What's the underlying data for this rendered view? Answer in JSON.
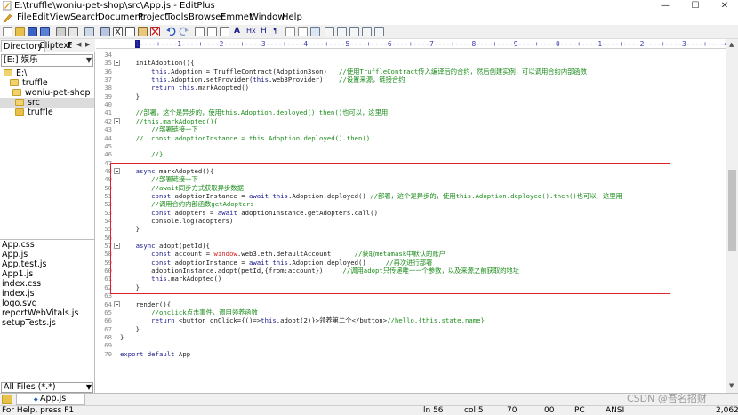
{
  "window": {
    "title": "E:\\truffle\\woniu-pet-shop\\src\\App.js - EditPlus",
    "minimize": "—",
    "maximize": "☐",
    "close": "✕"
  },
  "menu": [
    "File",
    "Edit",
    "View",
    "Search",
    "Document",
    "Project",
    "Tools",
    "Browser",
    "Emmet",
    "Window",
    "Help"
  ],
  "toolbar": {
    "buttons": [
      "new",
      "open",
      "save",
      "save-all",
      "print",
      "print-preview",
      "cut",
      "copy",
      "paste",
      "delete",
      "undo",
      "redo",
      "find",
      "replace",
      "go-to",
      "word-wrap",
      "hex",
      "html-preview",
      "bold",
      "italic",
      "browser",
      "ruler",
      "line-number",
      "settings",
      "cliptext",
      "directory",
      "output",
      "fullscreen",
      "window"
    ]
  },
  "sidebar": {
    "tabs": [
      "Directory",
      "Cliptext",
      "F"
    ],
    "drive": "[E:] 娱乐",
    "folders": [
      {
        "label": "E:\\",
        "level": 0,
        "open": true,
        "selected": false
      },
      {
        "label": "truffle",
        "level": 1,
        "open": true,
        "selected": false
      },
      {
        "label": "woniu-pet-shop",
        "level": 2,
        "open": true,
        "selected": false
      },
      {
        "label": "src",
        "level": 3,
        "open": true,
        "selected": true
      },
      {
        "label": "truffle",
        "level": 3,
        "open": false,
        "selected": false
      }
    ],
    "files": [
      "App.css",
      "App.js",
      "App.test.js",
      "App1.js",
      "index.css",
      "index.js",
      "logo.svg",
      "reportWebVitals.js",
      "setupTests.js"
    ],
    "filter": "All Files (*.*)"
  },
  "ruler": {
    "text": "1----+----1----+----2----+----3----+----4----+----5----+----6----+----7----+----8----+----9----+----0----+----1----+----2----+----3----+----4----+"
  },
  "editor": {
    "lines": [
      {
        "num": "34",
        "fold": false,
        "text": ""
      },
      {
        "num": "35",
        "fold": true,
        "text": "    initAdoption(){"
      },
      {
        "num": "36",
        "fold": false,
        "text": "        this.Adoption = TruffleContract(Adoption3son)   //使用TruffleContract传入编译后的合约，然后创建实例，可以调用合约内部函数"
      },
      {
        "num": "37",
        "fold": false,
        "text": "        this.Adoption.setProvider(this.web3Provider)    //设置来源，链接合约"
      },
      {
        "num": "38",
        "fold": false,
        "text": "        return this.markAdopted()"
      },
      {
        "num": "39",
        "fold": false,
        "text": "    }"
      },
      {
        "num": "40",
        "fold": false,
        "text": ""
      },
      {
        "num": "41",
        "fold": false,
        "text": "    //部署，这个是异步的，使用this.Adoption.deployed().then()也可以，这里用"
      },
      {
        "num": "42",
        "fold": true,
        "text": "    //this.markAdopted(){"
      },
      {
        "num": "43",
        "fold": false,
        "text": "        //部署链接一下"
      },
      {
        "num": "44",
        "fold": false,
        "text": "    //  const adoptionInstance = this.Adoption.deployed().then()"
      },
      {
        "num": "45",
        "fold": false,
        "text": ""
      },
      {
        "num": "46",
        "fold": false,
        "text": "        //}"
      },
      {
        "num": "47",
        "fold": false,
        "text": ""
      },
      {
        "num": "48",
        "fold": true,
        "text": "    async markAdopted(){"
      },
      {
        "num": "49",
        "fold": false,
        "text": "        //部署链接一下"
      },
      {
        "num": "50",
        "fold": false,
        "text": "        //await同步方式获取异步数据"
      },
      {
        "num": "51",
        "fold": false,
        "text": "        const adoptionInstance = await this.Adoption.deployed() //部署，这个是异步的，使用this.Adoption.deployed().then()也可以，这里用"
      },
      {
        "num": "52",
        "fold": false,
        "text": "        //调用合约内部函数getAdopters"
      },
      {
        "num": "53",
        "fold": false,
        "text": "        const adopters = await adoptionInstance.getAdopters.call()"
      },
      {
        "num": "54",
        "fold": false,
        "text": "        console.log(adopters)"
      },
      {
        "num": "55",
        "fold": false,
        "text": "    }"
      },
      {
        "num": "56",
        "fold": false,
        "text": ""
      },
      {
        "num": "57",
        "fold": true,
        "text": "    async adopt(petId){"
      },
      {
        "num": "58",
        "fold": false,
        "text": "        const account = window.web3.eth.defaultAccount      //获取metamask中默认的账户"
      },
      {
        "num": "59",
        "fold": false,
        "text": "        const adoptionInstance = await this.Adoption.deployed()     //再次进行部署"
      },
      {
        "num": "60",
        "fold": false,
        "text": "        adoptionInstance.adopt(petId,{from:account})     //调用adopt只传递唯一一个参数，以及来源之前获取的地址"
      },
      {
        "num": "61",
        "fold": false,
        "text": "        this.markAdopted()"
      },
      {
        "num": "62",
        "fold": false,
        "text": "    }"
      },
      {
        "num": "63",
        "fold": false,
        "text": ""
      },
      {
        "num": "64",
        "fold": true,
        "text": "    render(){"
      },
      {
        "num": "65",
        "fold": false,
        "text": "        //onclick点击事件，调用领养函数"
      },
      {
        "num": "66",
        "fold": false,
        "text": "        return <button onClick={()=>this.adopt(2)}>领养第二个</button>//hello,{this.state.name}"
      },
      {
        "num": "67",
        "fold": false,
        "text": "    }"
      },
      {
        "num": "68",
        "fold": false,
        "text": "}"
      },
      {
        "num": "69",
        "fold": false,
        "text": ""
      },
      {
        "num": "70",
        "fold": false,
        "text": "export default App"
      }
    ]
  },
  "doc_tabs": [
    {
      "label": "App.js",
      "active": true
    }
  ],
  "status": {
    "help": "For Help, press F1",
    "line": "ln 56",
    "col": "col 5",
    "chars": "70",
    "hex": "00",
    "eol": "PC",
    "encoding": "ANSI",
    "size": "2,062"
  },
  "watermark": "CSDN @吾名招财",
  "colors": {
    "highlight_box": "#e0202e",
    "keyword": "#1a1a8c",
    "comment": "#1a8c1a",
    "folder": "#e8c14a"
  }
}
